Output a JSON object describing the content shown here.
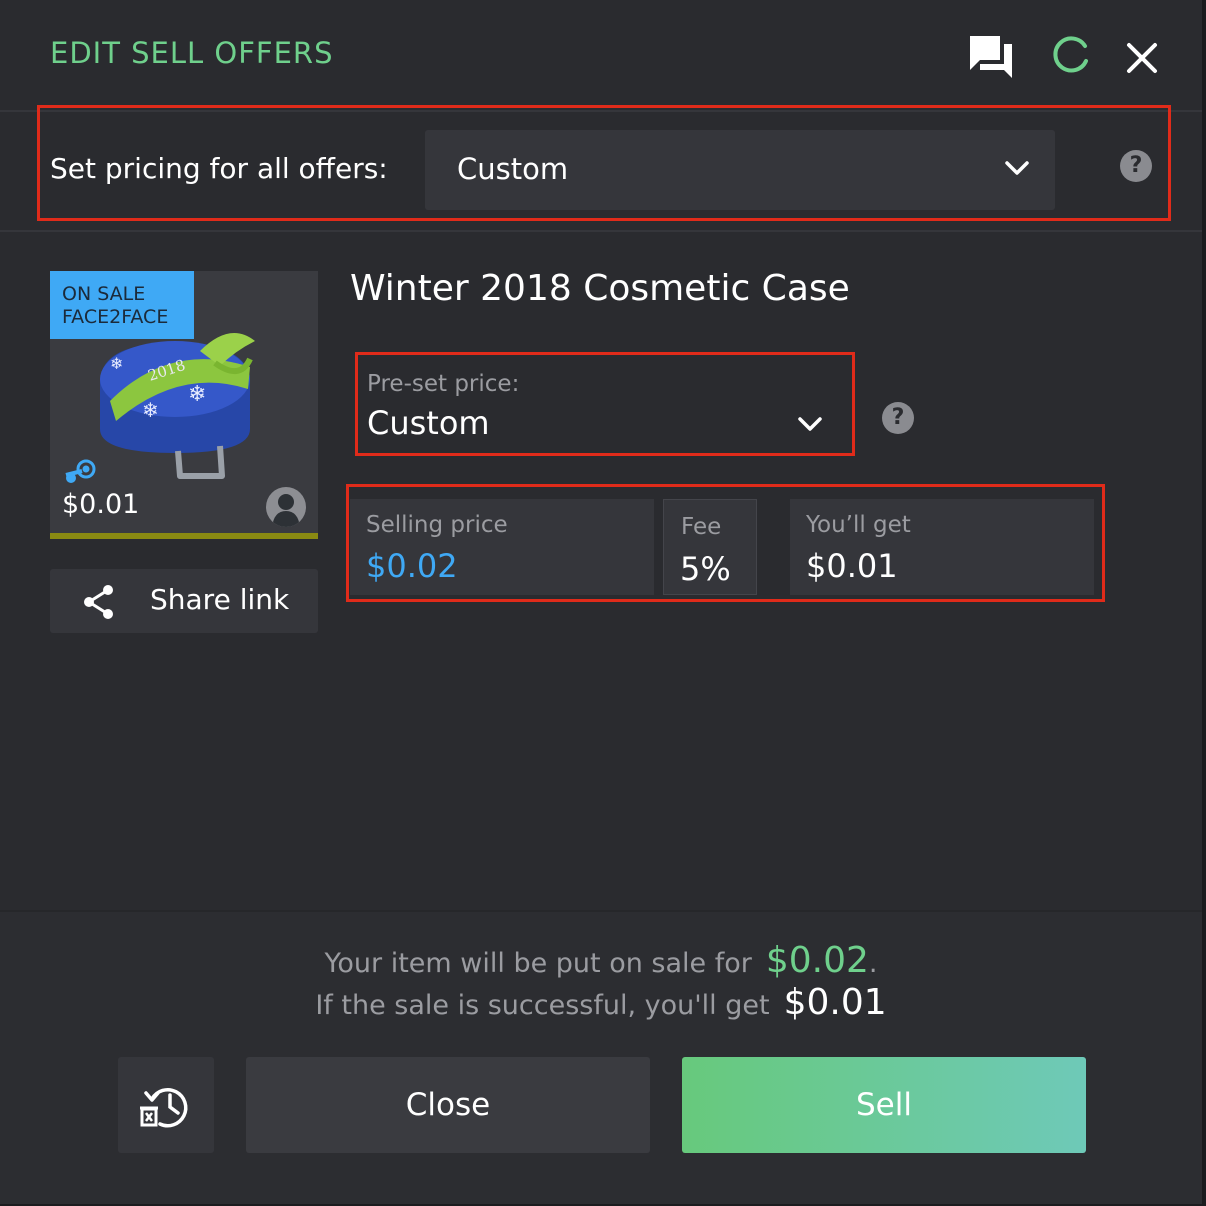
{
  "dialog": {
    "title": "EDIT SELL OFFERS",
    "icons": [
      "chat-icon",
      "refresh-icon",
      "close-icon"
    ]
  },
  "pricing_all": {
    "label": "Set pricing for all offers:",
    "selected": "Custom"
  },
  "item": {
    "badge_line1": "ON SALE",
    "badge_line2": "FACE2FACE",
    "price": "$0.01",
    "name": "Winter 2018 Cosmetic Case",
    "image_text": "2018"
  },
  "share": {
    "label": "Share link"
  },
  "preset": {
    "label": "Pre-set price:",
    "selected": "Custom"
  },
  "prices": {
    "selling_label": "Selling price",
    "selling_value": "$0.02",
    "fee_label": "Fee",
    "fee_value": "5%",
    "get_label": "You’ll get",
    "get_value": "$0.01"
  },
  "summary": {
    "line1_text": "Your item will be put on sale for",
    "line1_amount": "$0.02",
    "line1_period": ".",
    "line2_text": "If the sale is successful, you'll get",
    "line2_amount": "$0.01"
  },
  "buttons": {
    "close": "Close",
    "sell": "Sell"
  },
  "colors": {
    "accent_green": "#6fd08c",
    "price_blue": "#3fa9f5",
    "highlight_red": "#e02b1a",
    "background": "#2a2b2f"
  }
}
